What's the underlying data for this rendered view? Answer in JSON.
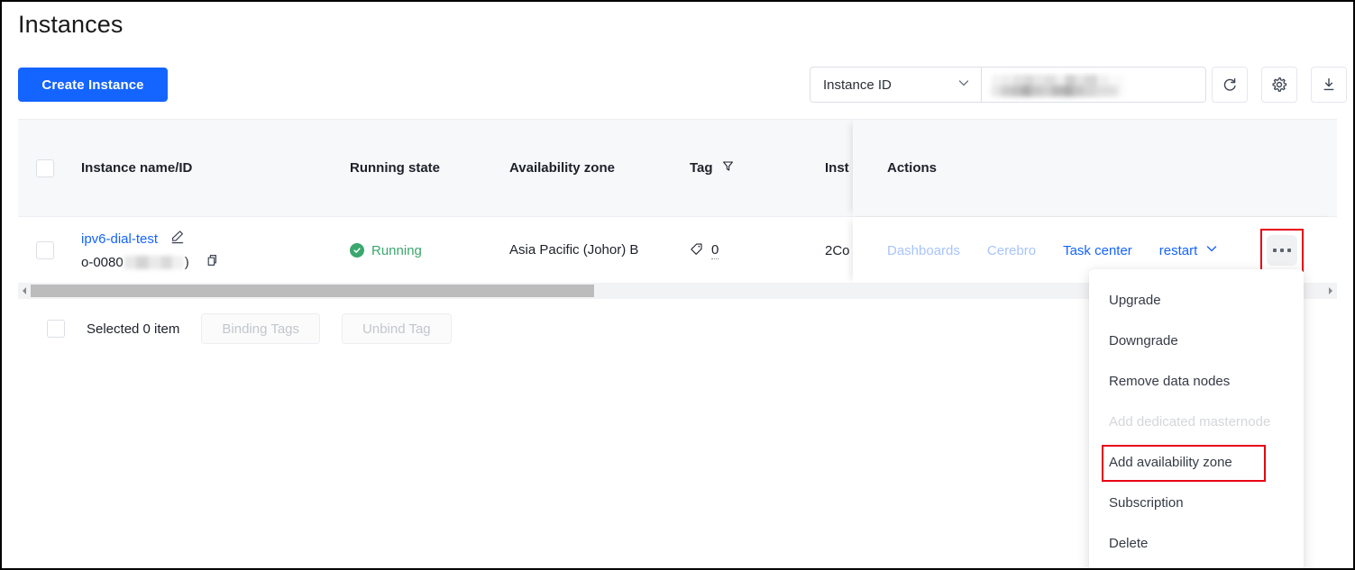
{
  "page": {
    "title": "Instances"
  },
  "toolbar": {
    "create_label": "Create Instance",
    "filter_field": "Instance ID",
    "search_value": "",
    "search_placeholder": "",
    "refresh_icon": "refresh-icon",
    "settings_icon": "gear-icon",
    "export_icon": "download-icon"
  },
  "table": {
    "columns": {
      "name": "Instance name/ID",
      "state": "Running state",
      "zone": "Availability zone",
      "tag": "Tag",
      "spec": "Inst",
      "actions": "Actions"
    },
    "rows": [
      {
        "name": "ipv6-dial-test",
        "id_prefix": "o-0080",
        "id_suffix": ")",
        "state": "Running",
        "zone": "Asia Pacific (Johor) B",
        "tag_count": "0",
        "spec": "2Co"
      }
    ],
    "actions": {
      "dashboards": "Dashboards",
      "cerebro": "Cerebro",
      "task_center": "Task center",
      "restart": "restart",
      "more": "more-actions"
    }
  },
  "footer": {
    "selected_text": "Selected 0 item",
    "binding_tags": "Binding Tags",
    "unbind_tag": "Unbind Tag"
  },
  "menu": {
    "items": [
      {
        "label": "Upgrade",
        "state": "normal"
      },
      {
        "label": "Downgrade",
        "state": "normal"
      },
      {
        "label": "Remove data nodes",
        "state": "normal"
      },
      {
        "label": "Add dedicated masternode",
        "state": "disabled"
      },
      {
        "label": "Add availability zone",
        "state": "highlighted"
      },
      {
        "label": "Subscription",
        "state": "normal"
      },
      {
        "label": "Delete",
        "state": "normal"
      }
    ]
  },
  "colors": {
    "primary": "#1464ff",
    "link_muted": "#a8c4fb",
    "success": "#3aa76d",
    "highlight": "#e60012",
    "header_bg": "#f7f8fa"
  }
}
